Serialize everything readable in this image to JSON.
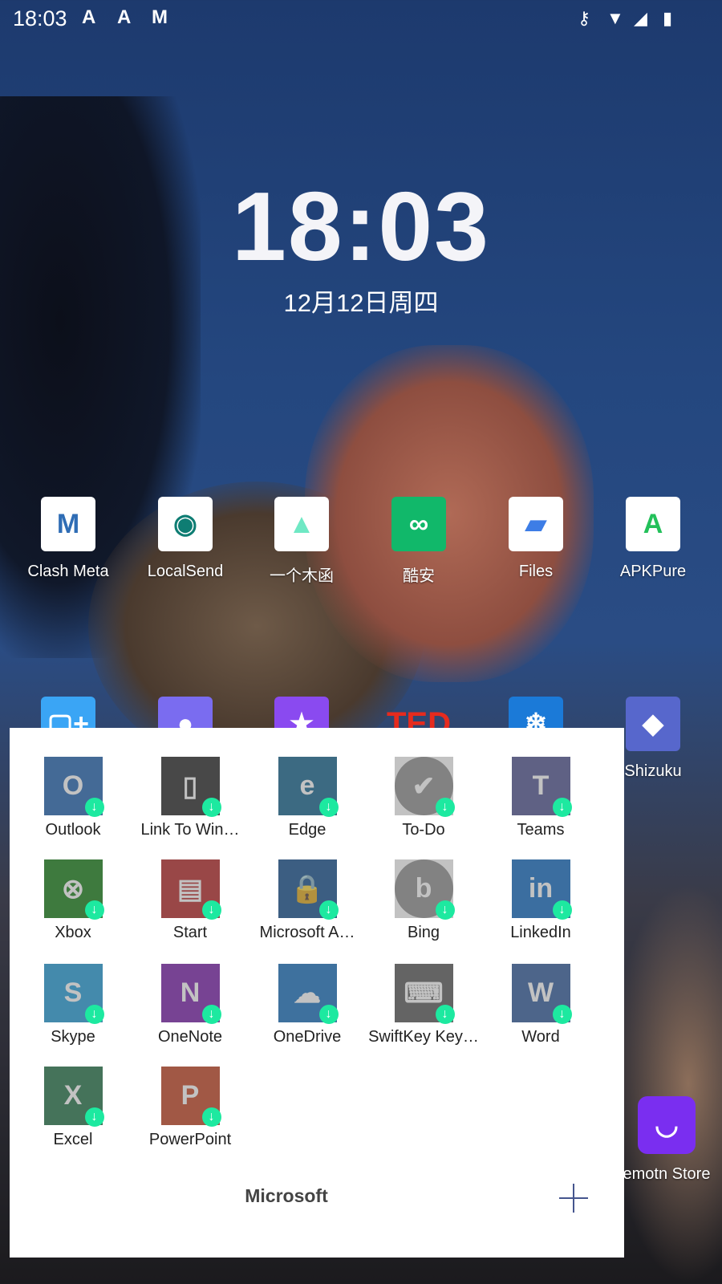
{
  "status_bar": {
    "time": "18:03",
    "notification_icons": [
      "apkpure-icon",
      "apkpure-icon",
      "clash-meta-icon"
    ],
    "system_icons": [
      "vpn-key-icon",
      "wifi-icon",
      "signal-icon",
      "battery-charging-icon"
    ]
  },
  "lock_clock": {
    "time": "18:03",
    "date": "12月12日周四"
  },
  "home_apps": [
    {
      "label": "Clash Meta",
      "glyph": "M",
      "bg": "#ffffff",
      "fg": "#2f6db5"
    },
    {
      "label": "LocalSend",
      "glyph": "◉",
      "bg": "#ffffff",
      "fg": "#0e7d73"
    },
    {
      "label": "一个木函",
      "glyph": "▲",
      "bg": "#ffffff",
      "fg": "#6fe8c4"
    },
    {
      "label": "酷安",
      "glyph": "∞",
      "bg": "#11b86a",
      "fg": "#ffffff"
    },
    {
      "label": "Files",
      "glyph": "▰",
      "bg": "#ffffff",
      "fg": "#3d7de6"
    },
    {
      "label": "APKPure",
      "glyph": "A",
      "bg": "#ffffff",
      "fg": "#23c05a"
    }
  ],
  "home_apps_row2": [
    {
      "label": "",
      "glyph": "▢+",
      "bg": "#3aa5f5"
    },
    {
      "label": "",
      "glyph": "●",
      "bg": "#7a6cf0"
    },
    {
      "label": "",
      "glyph": "★",
      "bg": "#8a4af0"
    },
    {
      "label": "",
      "glyph": "TED",
      "bg": "transparent"
    },
    {
      "label": "",
      "glyph": "❄",
      "bg": "#1b7ad8"
    },
    {
      "label": "Shizuku",
      "glyph": "◆",
      "bg": "#5767cc"
    }
  ],
  "home_app_partial": {
    "label": "emotn Store",
    "glyph": "◡",
    "bg": "#7a2ef0"
  },
  "folder": {
    "name": "Microsoft",
    "add_label": "add-app",
    "apps": [
      {
        "label": "Outlook",
        "glyph": "O",
        "bg": "#1a5fb0"
      },
      {
        "label": "Link To Win…",
        "glyph": "▯",
        "bg": "#222222"
      },
      {
        "label": "Edge",
        "glyph": "e",
        "bg": "#0b5f8a"
      },
      {
        "label": "To-Do",
        "glyph": "✔",
        "bg": "#8a8a8a",
        "round": true
      },
      {
        "label": "Teams",
        "glyph": "T",
        "bg": "#4b4f8e"
      },
      {
        "label": "Xbox",
        "glyph": "⊗",
        "bg": "#107c10"
      },
      {
        "label": "Start",
        "glyph": "▤",
        "bg": "#b41f1f"
      },
      {
        "label": "Microsoft A…",
        "glyph": "🔒",
        "bg": "#0c4a8a"
      },
      {
        "label": "Bing",
        "glyph": "b",
        "bg": "#8a8a8a",
        "round": true
      },
      {
        "label": "LinkedIn",
        "glyph": "in",
        "bg": "#0a66c2"
      },
      {
        "label": "Skype",
        "glyph": "S",
        "bg": "#1a9ad8"
      },
      {
        "label": "OneNote",
        "glyph": "N",
        "bg": "#7719aa"
      },
      {
        "label": "OneDrive",
        "glyph": "☁",
        "bg": "#0f6cbd"
      },
      {
        "label": "SwiftKey Key…",
        "glyph": "⌨",
        "bg": "#555555"
      },
      {
        "label": "Word",
        "glyph": "W",
        "bg": "#2b579a"
      },
      {
        "label": "Excel",
        "glyph": "X",
        "bg": "#1d6f42"
      },
      {
        "label": "PowerPoint",
        "glyph": "P",
        "bg": "#c43e1c"
      }
    ],
    "badge_glyph": "↓"
  }
}
